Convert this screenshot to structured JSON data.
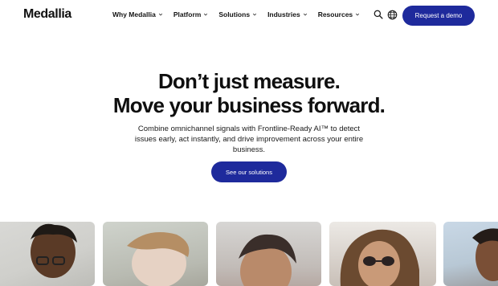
{
  "brand": {
    "logo": "Medallia",
    "accent": "#1e2a9c"
  },
  "nav": {
    "items": [
      {
        "label": "Why Medallia"
      },
      {
        "label": "Platform"
      },
      {
        "label": "Solutions"
      },
      {
        "label": "Industries"
      },
      {
        "label": "Resources"
      }
    ],
    "search_icon": "search-icon",
    "globe_icon": "globe-icon",
    "demo_label": "Request a demo"
  },
  "hero": {
    "headline_line1": "Don’t just measure.",
    "headline_line2": "Move your business forward.",
    "subcopy": "Combine omnichannel signals with Frontline-Ready AI™ to detect issues early, act instantly, and drive improvement across your entire business.",
    "cta_label": "See our solutions"
  },
  "cards": [
    {
      "name": "person-photo-1"
    },
    {
      "name": "person-photo-2"
    },
    {
      "name": "person-photo-3"
    },
    {
      "name": "person-photo-4"
    },
    {
      "name": "person-photo-5"
    }
  ]
}
